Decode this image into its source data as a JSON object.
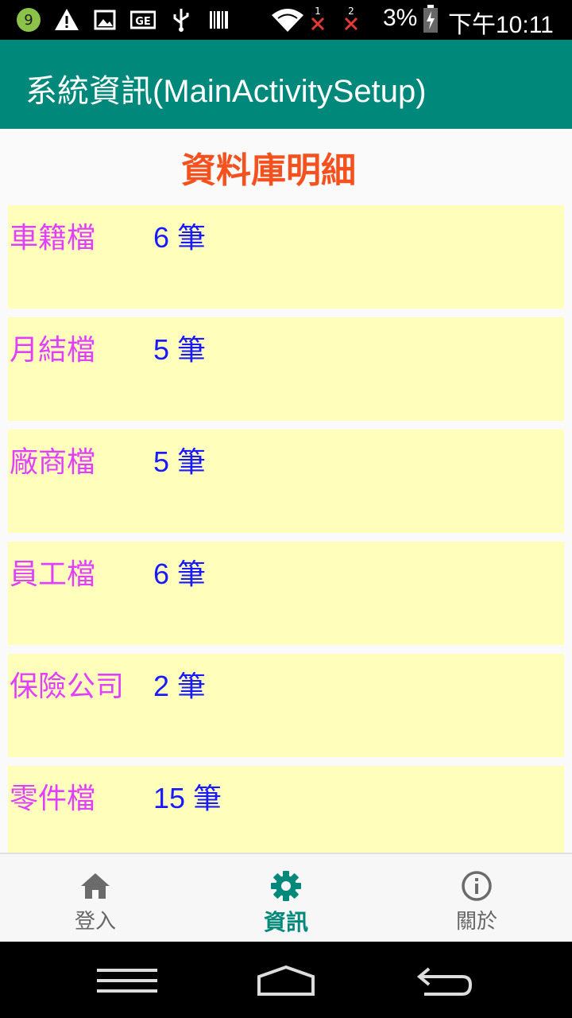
{
  "status_bar": {
    "notification_badge": "9",
    "sim1_label": "1",
    "sim2_label": "2",
    "battery": "3%",
    "time": "下午10:11",
    "icons": [
      "badge-icon",
      "warning-icon",
      "image-icon",
      "ge-icon",
      "usb-icon",
      "barcode-icon",
      "wifi-icon",
      "signal-x-icon",
      "signal-x-icon",
      "battery-icon"
    ]
  },
  "app_bar": {
    "title": "系統資訊(MainActivitySetup)"
  },
  "content": {
    "section_title": "資料庫明細",
    "rows": [
      {
        "name": "車籍檔",
        "count": "6 筆"
      },
      {
        "name": "月結檔",
        "count": "5 筆"
      },
      {
        "name": "廠商檔",
        "count": "5 筆"
      },
      {
        "name": "員工檔",
        "count": "6 筆"
      },
      {
        "name": "保險公司",
        "count": "2 筆"
      },
      {
        "name": "零件檔",
        "count": "15 筆"
      }
    ]
  },
  "bottom_nav": {
    "items": [
      {
        "label": "登入",
        "icon": "home-icon",
        "active": false
      },
      {
        "label": "資訊",
        "icon": "gear-icon",
        "active": true
      },
      {
        "label": "關於",
        "icon": "info-icon",
        "active": false
      }
    ]
  },
  "colors": {
    "app_bar": "#00897b",
    "section_title": "#f4511e",
    "row_background": "#ffffbb",
    "row_name": "#e040fb",
    "row_count": "#1a1aff"
  }
}
